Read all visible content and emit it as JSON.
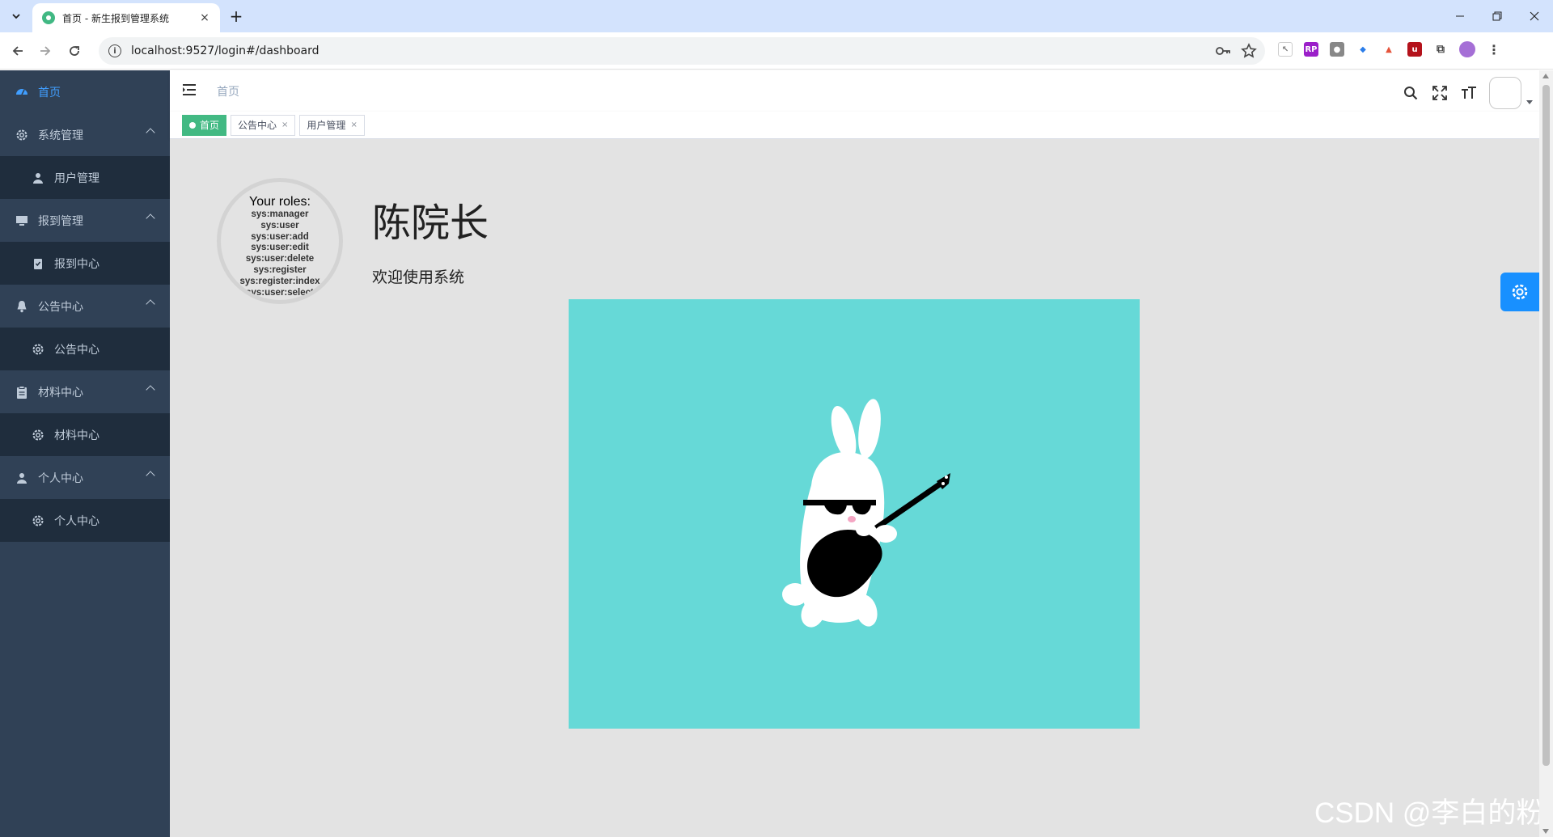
{
  "browser": {
    "tab_title": "首页 - 新生报到管理系统",
    "url": "localhost:9527/login#/dashboard",
    "new_tab_label": "+",
    "close_tab_label": "×"
  },
  "sidebar": {
    "items": [
      {
        "label": "首页",
        "icon": "dashboard-icon",
        "active": true
      },
      {
        "label": "系统管理",
        "icon": "gear-icon",
        "children": [
          {
            "label": "用户管理",
            "icon": "user-icon"
          }
        ]
      },
      {
        "label": "报到管理",
        "icon": "monitor-icon",
        "children": [
          {
            "label": "报到中心",
            "icon": "checklist-icon"
          }
        ]
      },
      {
        "label": "公告中心",
        "icon": "bell-icon",
        "children": [
          {
            "label": "公告中心",
            "icon": "gear-icon"
          }
        ]
      },
      {
        "label": "材料中心",
        "icon": "clipboard-icon",
        "children": [
          {
            "label": "材料中心",
            "icon": "gear-icon"
          }
        ]
      },
      {
        "label": "个人中心",
        "icon": "user-icon",
        "children": [
          {
            "label": "个人中心",
            "icon": "gear-icon"
          }
        ]
      }
    ]
  },
  "navbar": {
    "breadcrumb": "首页"
  },
  "tags": [
    {
      "label": "首页",
      "active": true
    },
    {
      "label": "公告中心",
      "closable": true
    },
    {
      "label": "用户管理",
      "closable": true
    }
  ],
  "dashboard": {
    "roles_title": "Your roles:",
    "roles": [
      "sys:manager",
      "sys:user",
      "sys:user:add",
      "sys:user:edit",
      "sys:user:delete",
      "sys:register",
      "sys:register:index",
      "sys:user:select"
    ],
    "user_name": "陈院长",
    "welcome": "欢迎使用系统"
  },
  "watermark": "CSDN @李白的粉",
  "colors": {
    "sidebar_bg": "#304156",
    "sidebar_active": "#409eff",
    "tag_active": "#42b983",
    "emoji_bg": "#66d9d7",
    "settings_btn": "#1890ff"
  }
}
